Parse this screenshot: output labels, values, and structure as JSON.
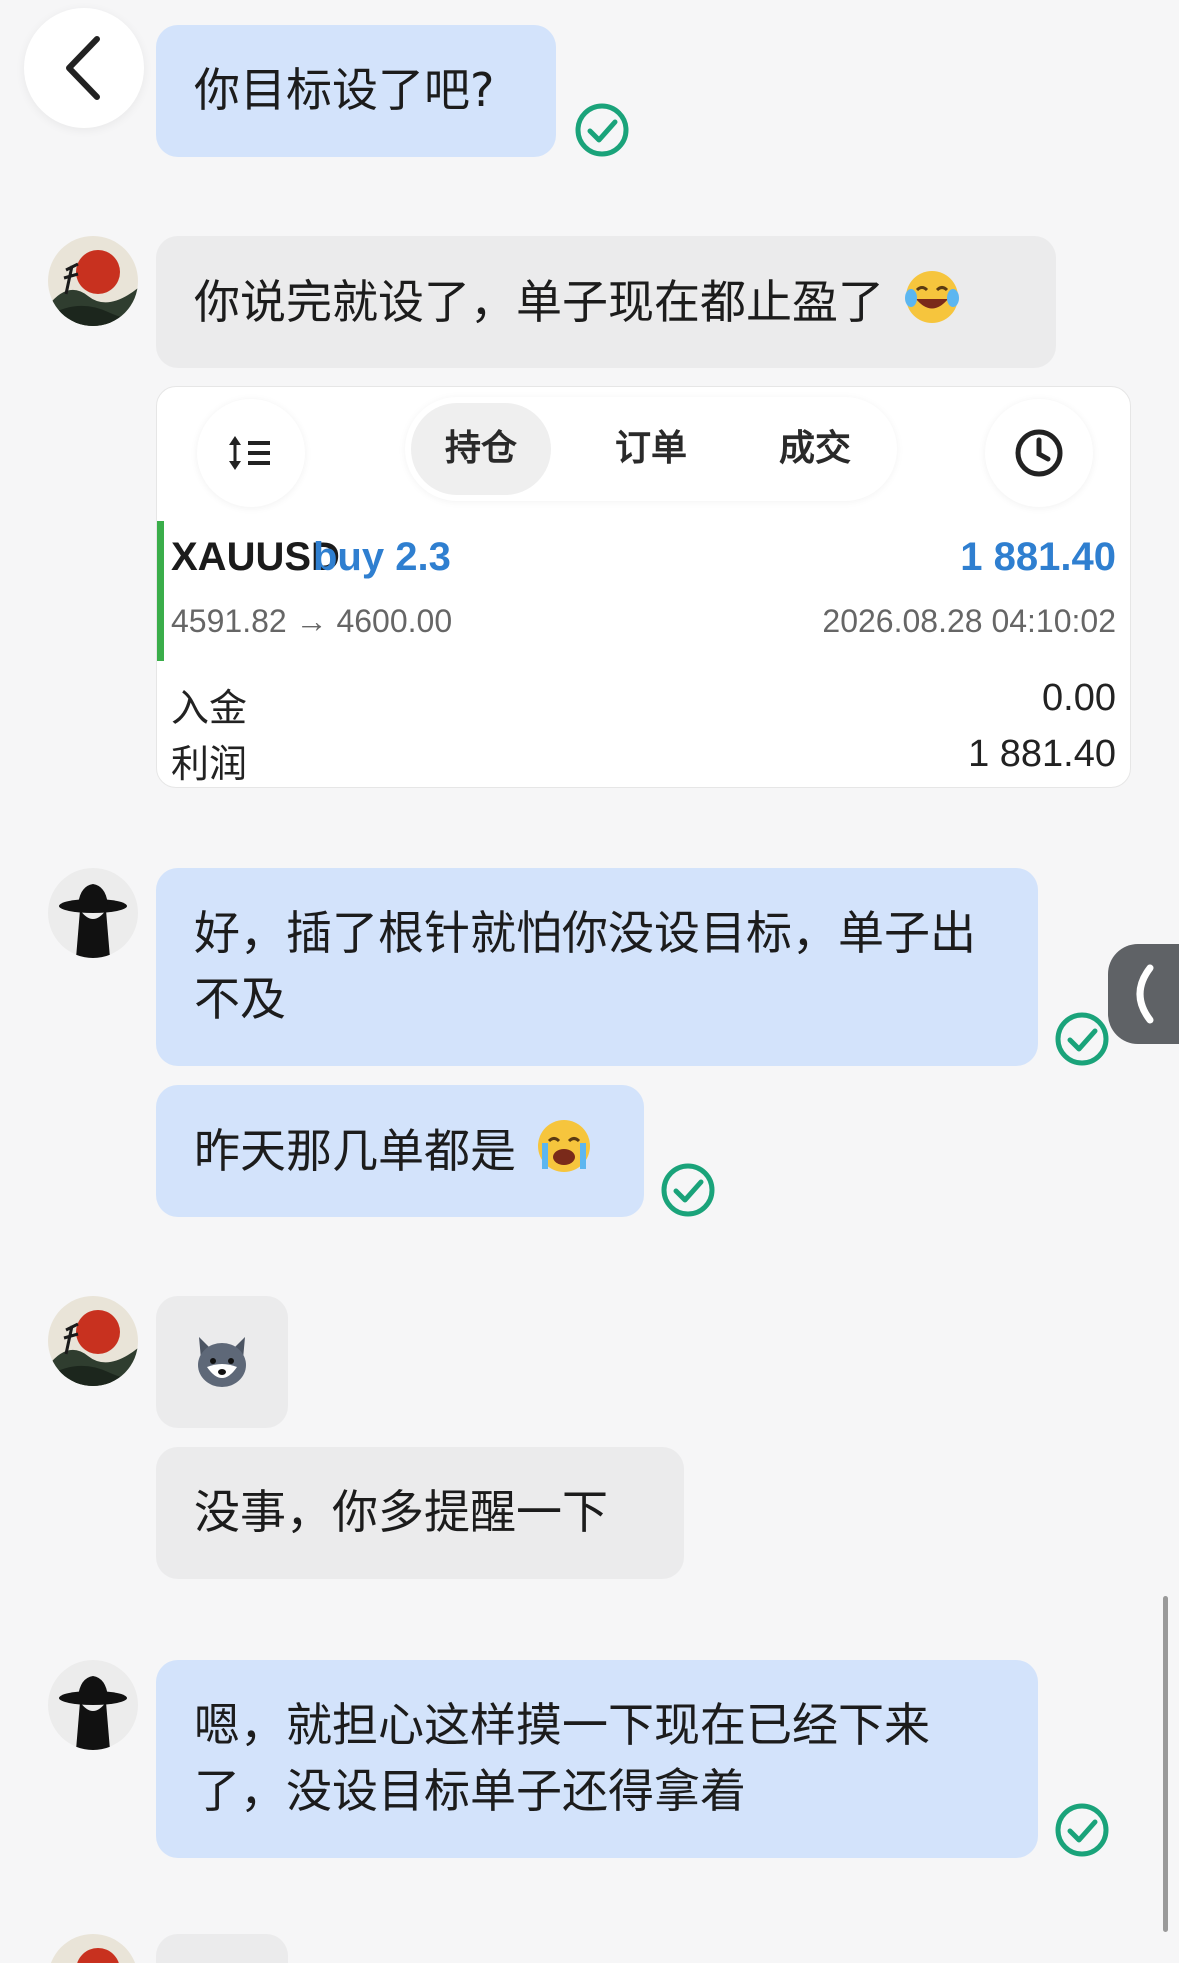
{
  "messages": [
    {
      "text": "你目标设了吧?"
    },
    {
      "text": "你说完就设了，单子现在都止盈了",
      "emoji": "laughing-tears-emoji"
    },
    {
      "text": "好，插了根针就怕你没设目标，单子出不及"
    },
    {
      "text": "昨天那几单都是",
      "emoji": "crying-emoji"
    },
    {
      "sticker": "husky-dog-sticker"
    },
    {
      "text": "没事，你多提醒一下"
    },
    {
      "text": "嗯，就担心这样摸一下现在已经下来了，没设目标单子还得拿着"
    }
  ],
  "trade_card": {
    "tabs": [
      "持仓",
      "订单",
      "成交"
    ],
    "active_tab": "持仓",
    "symbol": "XAUUSD",
    "side": "buy 2.3",
    "profit": "1 881.40",
    "price_range": "4591.82 → 4600.00",
    "datetime": "2026.08.28 04:10:02",
    "rows": [
      {
        "label": "入金",
        "value": "0.00"
      },
      {
        "label": "利润",
        "value": "1 881.40"
      }
    ]
  },
  "colors": {
    "mine_bubble": "#d3e3fb",
    "theirs_bubble": "#ebebec",
    "check": "#1aa37a",
    "profit_blue": "#2f7fd0",
    "position_green": "#3aae4a"
  }
}
